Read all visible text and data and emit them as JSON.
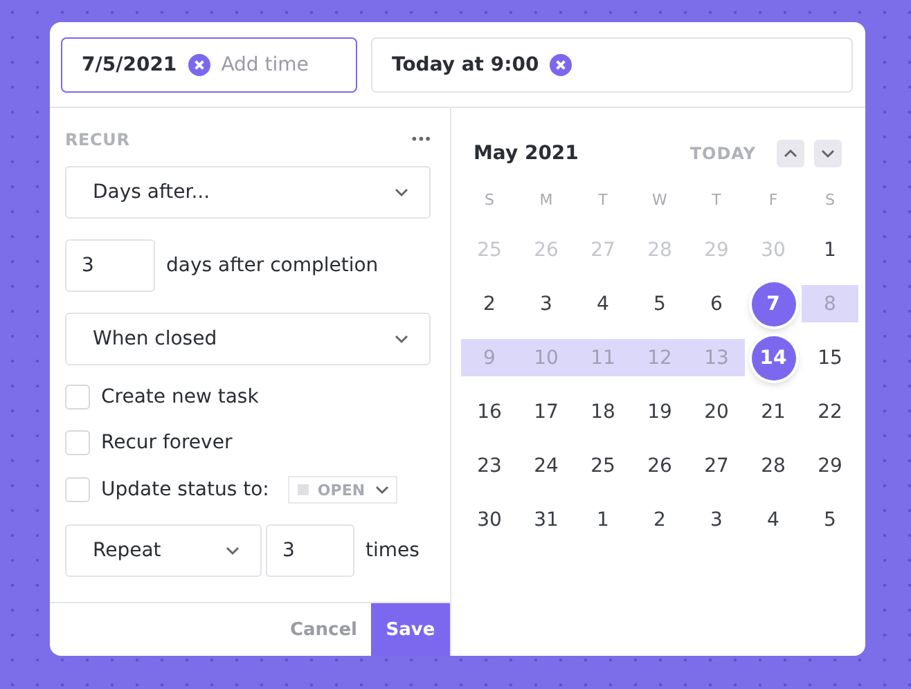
{
  "date_field": {
    "value": "7/5/2021",
    "placeholder": "Add time"
  },
  "due_field": {
    "value": "Today at 9:00"
  },
  "recur": {
    "title": "RECUR",
    "more": "•••",
    "frequency": {
      "value": "Days after..."
    },
    "interval": {
      "value": "3",
      "suffix": "days after completion"
    },
    "trigger": {
      "value": "When closed"
    },
    "options": [
      {
        "label": "Create new task",
        "checked": false
      },
      {
        "label": "Recur forever",
        "checked": false
      },
      {
        "label": "Update status to:",
        "checked": false,
        "status": "OPEN"
      }
    ],
    "repeat": {
      "value": "Repeat",
      "count": "3",
      "suffix": "times"
    }
  },
  "footer": {
    "cancel": "Cancel",
    "save": "Save"
  },
  "calendar": {
    "month": "May 2021",
    "today": "TODAY",
    "weekdays": [
      "S",
      "M",
      "T",
      "W",
      "T",
      "F",
      "S"
    ],
    "weeks": [
      [
        {
          "label": "25",
          "muted": true,
          "in_range": false,
          "selected": false
        },
        {
          "label": "26",
          "muted": true,
          "in_range": false,
          "selected": false
        },
        {
          "label": "27",
          "muted": true,
          "in_range": false,
          "selected": false
        },
        {
          "label": "28",
          "muted": true,
          "in_range": false,
          "selected": false
        },
        {
          "label": "29",
          "muted": true,
          "in_range": false,
          "selected": false
        },
        {
          "label": "30",
          "muted": true,
          "in_range": false,
          "selected": false
        },
        {
          "label": "1",
          "muted": false,
          "in_range": false,
          "selected": false
        }
      ],
      [
        {
          "label": "2",
          "muted": false,
          "in_range": false,
          "selected": false
        },
        {
          "label": "3",
          "muted": false,
          "in_range": false,
          "selected": false
        },
        {
          "label": "4",
          "muted": false,
          "in_range": false,
          "selected": false
        },
        {
          "label": "5",
          "muted": false,
          "in_range": false,
          "selected": false
        },
        {
          "label": "6",
          "muted": false,
          "in_range": false,
          "selected": false
        },
        {
          "label": "7",
          "muted": false,
          "in_range": false,
          "selected": true
        },
        {
          "label": "8",
          "muted": false,
          "in_range": true,
          "selected": false
        }
      ],
      [
        {
          "label": "9",
          "muted": false,
          "in_range": true,
          "selected": false
        },
        {
          "label": "10",
          "muted": false,
          "in_range": true,
          "selected": false
        },
        {
          "label": "11",
          "muted": false,
          "in_range": true,
          "selected": false
        },
        {
          "label": "12",
          "muted": false,
          "in_range": true,
          "selected": false
        },
        {
          "label": "13",
          "muted": false,
          "in_range": true,
          "selected": false
        },
        {
          "label": "14",
          "muted": false,
          "in_range": false,
          "selected": true
        },
        {
          "label": "15",
          "muted": false,
          "in_range": false,
          "selected": false
        }
      ],
      [
        {
          "label": "16",
          "muted": false,
          "in_range": false,
          "selected": false
        },
        {
          "label": "17",
          "muted": false,
          "in_range": false,
          "selected": false
        },
        {
          "label": "18",
          "muted": false,
          "in_range": false,
          "selected": false
        },
        {
          "label": "19",
          "muted": false,
          "in_range": false,
          "selected": false
        },
        {
          "label": "20",
          "muted": false,
          "in_range": false,
          "selected": false
        },
        {
          "label": "21",
          "muted": false,
          "in_range": false,
          "selected": false
        },
        {
          "label": "22",
          "muted": false,
          "in_range": false,
          "selected": false
        }
      ],
      [
        {
          "label": "23",
          "muted": false,
          "in_range": false,
          "selected": false
        },
        {
          "label": "24",
          "muted": false,
          "in_range": false,
          "selected": false
        },
        {
          "label": "25",
          "muted": false,
          "in_range": false,
          "selected": false
        },
        {
          "label": "26",
          "muted": false,
          "in_range": false,
          "selected": false
        },
        {
          "label": "27",
          "muted": false,
          "in_range": false,
          "selected": false
        },
        {
          "label": "28",
          "muted": false,
          "in_range": false,
          "selected": false
        },
        {
          "label": "29",
          "muted": false,
          "in_range": false,
          "selected": false
        }
      ],
      [
        {
          "label": "30",
          "muted": false,
          "in_range": false,
          "selected": false
        },
        {
          "label": "31",
          "muted": false,
          "in_range": false,
          "selected": false
        },
        {
          "label": "1",
          "muted": false,
          "in_range": false,
          "selected": false
        },
        {
          "label": "2",
          "muted": false,
          "in_range": false,
          "selected": false
        },
        {
          "label": "3",
          "muted": false,
          "in_range": false,
          "selected": false
        },
        {
          "label": "4",
          "muted": false,
          "in_range": false,
          "selected": false
        },
        {
          "label": "5",
          "muted": false,
          "in_range": false,
          "selected": false
        }
      ]
    ]
  }
}
